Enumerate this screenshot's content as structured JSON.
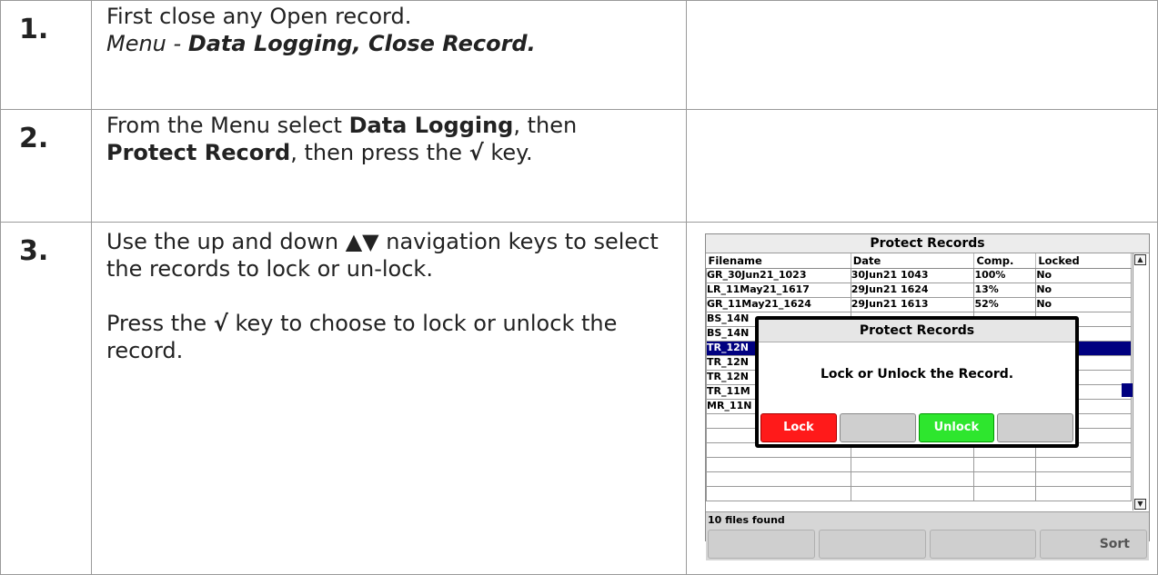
{
  "steps": [
    {
      "number": "1.",
      "line1": "First close any Open record.",
      "menu_prefix": "Menu - ",
      "menu_path": "Data Logging, Close Record."
    },
    {
      "number": "2.",
      "t1": "From the Menu select ",
      "b1": "Data Logging",
      "t2": ", then ",
      "b2": "Protect Record",
      "t3": ", then press the ",
      "check": "√",
      "t4": " key."
    },
    {
      "number": "3.",
      "p1": "Use the up and down ▲▼ navigation keys to select the records to lock or un-lock.",
      "p2a": "Press the ",
      "check": "√",
      "p2b": " key to choose to lock or unlock the record."
    }
  ],
  "device": {
    "title": "Protect Records",
    "columns": [
      "Filename",
      "Date",
      "Comp.",
      "Locked"
    ],
    "rows": [
      [
        "GR_30Jun21_1023",
        "30Jun21 1043",
        "100%",
        "No"
      ],
      [
        "LR_11May21_1617",
        "29Jun21 1624",
        "13%",
        "No"
      ],
      [
        "GR_11May21_1624",
        "29Jun21 1613",
        "52%",
        "No"
      ],
      [
        "BS_14N",
        "",
        "",
        ""
      ],
      [
        "BS_14N",
        "",
        "",
        ""
      ],
      [
        "TR_12N",
        "",
        "",
        ""
      ],
      [
        "TR_12N",
        "",
        "",
        ""
      ],
      [
        "TR_12N",
        "",
        "",
        ""
      ],
      [
        "TR_11M",
        "",
        "",
        ""
      ],
      [
        "MR_11N",
        "",
        "",
        ""
      ],
      [
        "",
        "",
        "",
        ""
      ],
      [
        "",
        "",
        "",
        ""
      ],
      [
        "",
        "",
        "",
        ""
      ],
      [
        "",
        "",
        "",
        ""
      ],
      [
        "",
        "",
        "",
        ""
      ],
      [
        "",
        "",
        "",
        ""
      ]
    ],
    "selected_row": 5,
    "status": "10 files found",
    "softkeys": [
      "",
      "",
      "",
      "Sort"
    ],
    "dialog": {
      "title": "Protect Records",
      "message": "Lock or Unlock the Record.",
      "buttons": [
        "Lock",
        "",
        "Unlock",
        ""
      ]
    },
    "colors": {
      "lock": "#ff1a1a",
      "unlock": "#2ee62e",
      "selection": "#000080"
    }
  }
}
